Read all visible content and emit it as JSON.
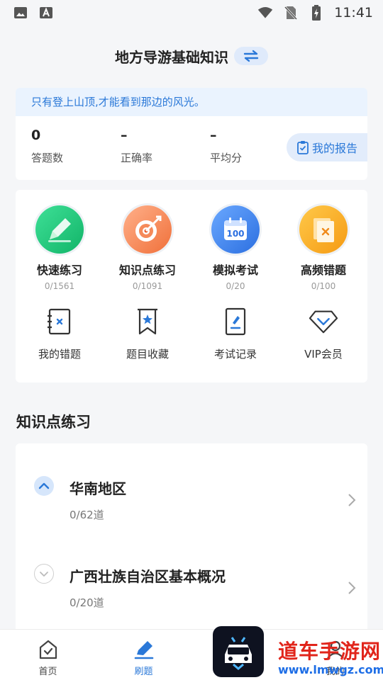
{
  "status_bar": {
    "time": "11:41"
  },
  "header": {
    "title": "地方导游基础知识"
  },
  "motto": "只有登上山顶,才能看到那边的风光。",
  "stats": [
    {
      "value": "0",
      "label": "答题数"
    },
    {
      "value": "–",
      "label": "正确率"
    },
    {
      "value": "–",
      "label": "平均分"
    }
  ],
  "report_label": "我的报告",
  "practice_modes": [
    {
      "name": "快速练习",
      "count": "0/1561",
      "icon": "pencil-icon",
      "color": "#1fc57a"
    },
    {
      "name": "知识点练习",
      "count": "0/1091",
      "icon": "target-icon",
      "color": "#f07a42"
    },
    {
      "name": "模拟考试",
      "count": "0/20",
      "icon": "calendar-100-icon",
      "color": "#2f7fe8"
    },
    {
      "name": "高频错题",
      "count": "0/100",
      "icon": "wrong-book-icon",
      "color": "#f7a21b"
    }
  ],
  "tools": [
    {
      "name": "我的错题",
      "icon": "wrong-notebook-icon"
    },
    {
      "name": "题目收藏",
      "icon": "bookmark-star-icon"
    },
    {
      "name": "考试记录",
      "icon": "exam-record-icon"
    },
    {
      "name": "VIP会员",
      "icon": "diamond-icon"
    }
  ],
  "section_title": "知识点练习",
  "knowledge_items": [
    {
      "title": "华南地区",
      "progress": "0/62道",
      "expanded": true
    },
    {
      "title": "广西壮族自治区基本概况",
      "progress": "0/20道",
      "expanded": false
    }
  ],
  "tabs": [
    {
      "label": "首页",
      "icon": "home-check-icon",
      "active": false
    },
    {
      "label": "刷题",
      "icon": "pen-tab-icon",
      "active": true
    },
    {
      "label": "",
      "icon": "",
      "active": false
    },
    {
      "label": "我的",
      "icon": "user-icon",
      "active": false
    }
  ],
  "watermark": {
    "line1": "道车手游网",
    "line2": "www.lmwgz.com"
  },
  "colors": {
    "accent": "#2a78d8",
    "background": "#f5f6f8"
  }
}
